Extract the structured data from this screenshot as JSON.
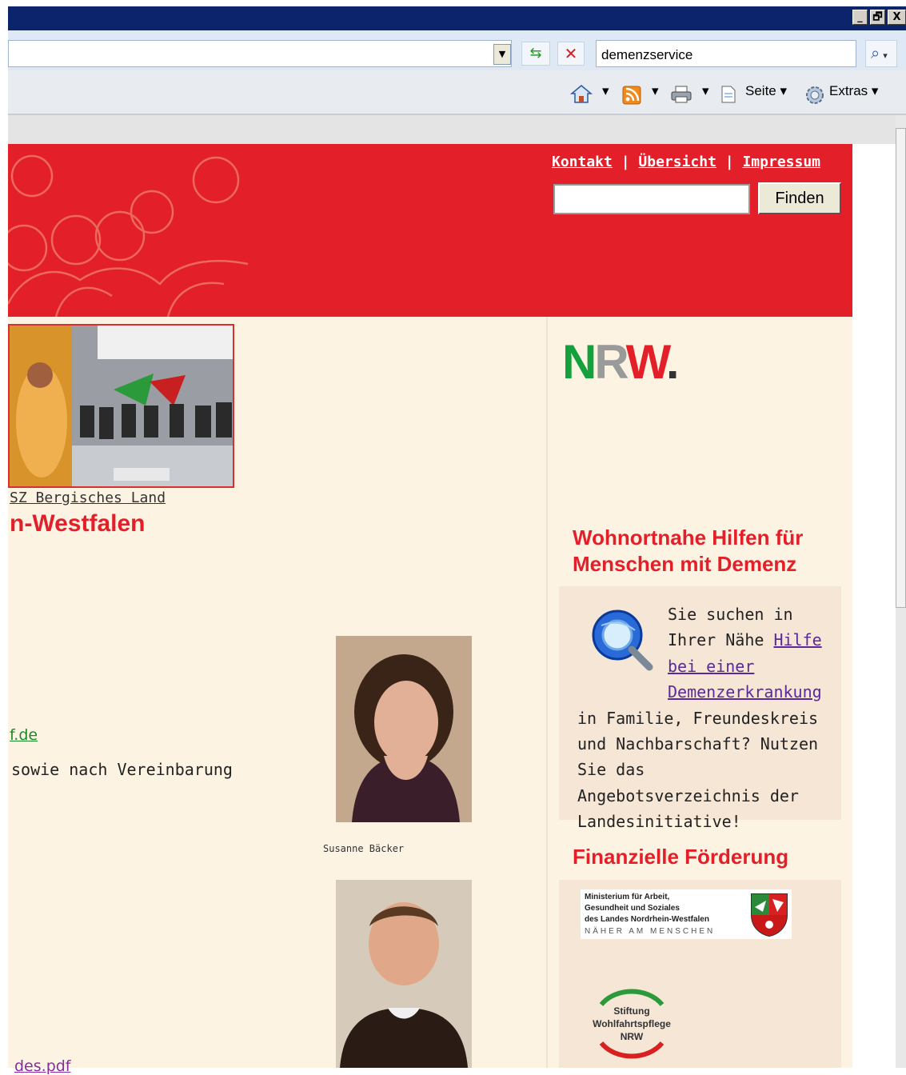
{
  "browser": {
    "search_value": "demenzservice",
    "commands": {
      "page_label": "Seite",
      "tools_label": "Extras"
    },
    "window_buttons": [
      "_",
      "🗗",
      "X"
    ]
  },
  "site": {
    "top_links": [
      "Kontakt",
      "Übersicht",
      "Impressum"
    ],
    "link_separator": "|",
    "search_button": "Finden"
  },
  "main": {
    "photo_caption": "SZ Bergisches Land",
    "heading": "n-Westfalen",
    "email_partial": "f.de",
    "hours_partial": "sowie nach Vereinbarung",
    "person1_caption": "Susanne Bäcker",
    "pdf_partial": "des.pdf"
  },
  "sidebar": {
    "logo_text": "NRW.",
    "section1": {
      "title": "Wohnortnahe Hilfen für Menschen mit Demenz",
      "text_before": "Sie suchen in Ihrer Nähe",
      "link": "Hilfe bei einer Demenzerkrankung",
      "text_after": "in Familie, Freundeskreis und Nachbarschaft? Nutzen Sie das Angebotsverzeichnis der Landesinitiative!"
    },
    "section2": {
      "title": "Finanzielle Förderung",
      "ministry_lines": [
        "Ministerium für Arbeit,",
        "Gesundheit und Soziales",
        "des Landes Nordrhein-Westfalen"
      ],
      "ministry_motto": "NÄHER AM MENSCHEN",
      "stiftung_lines": [
        "Stiftung",
        "Wohlfahrtspflege",
        "NRW"
      ]
    }
  },
  "colors": {
    "brand_red": "#e3202a",
    "page_bg": "#fdf3e3",
    "box_bg": "#f5e6d6",
    "nrw_green": "#14a03c",
    "nrw_gray": "#9a9a9a"
  }
}
